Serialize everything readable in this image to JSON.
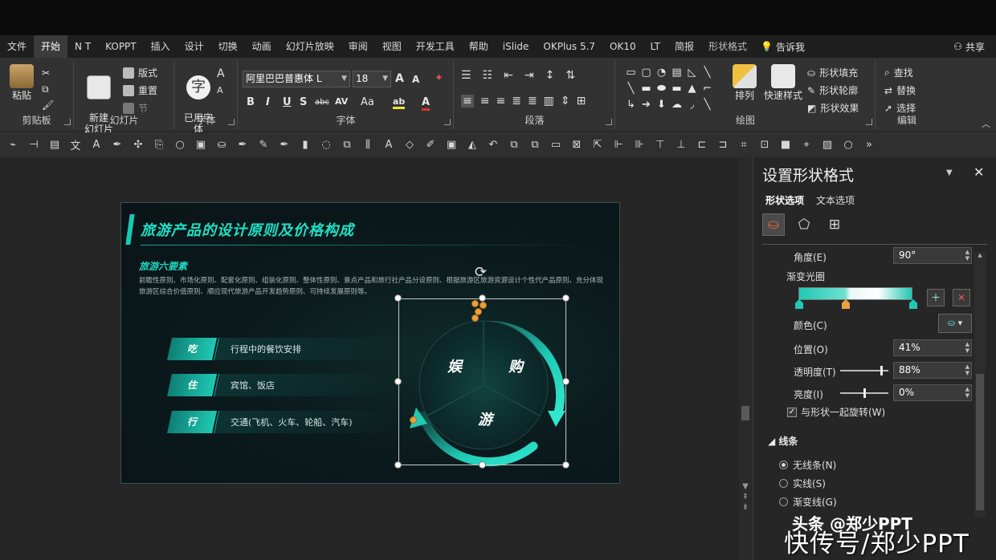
{
  "tabs": [
    "文件",
    "开始",
    "N T",
    "KOPPT",
    "插入",
    "设计",
    "切换",
    "动画",
    "幻灯片放映",
    "审阅",
    "视图",
    "开发工具",
    "帮助",
    "iSlide",
    "OKPlus 5.7",
    "OK10",
    "LT",
    "简报",
    "形状格式"
  ],
  "active_tab": "开始",
  "tell_me": "告诉我",
  "share": "共享",
  "ribbon": {
    "clipboard": {
      "paste": "粘贴",
      "label": "剪贴板"
    },
    "slides": {
      "new_slide": "新建\n幻灯片",
      "layout": "版式",
      "reset": "重置",
      "section": "节",
      "label": "幻灯片"
    },
    "font_used": {
      "btn": "已用字\n体",
      "label": "字体"
    },
    "font": {
      "family": "阿里巴巴普惠体 L",
      "size": "18",
      "label": "字体",
      "bold": "B",
      "italic": "I",
      "underline": "U",
      "strike": "S",
      "abc": "abc",
      "spacing": "AV",
      "case": "Aa"
    },
    "paragraph": {
      "label": "段落"
    },
    "drawing": {
      "arrange": "排列",
      "quick_styles": "快速样式",
      "fill": "形状填充",
      "outline": "形状轮廓",
      "effects": "形状效果",
      "label": "绘图"
    },
    "editing": {
      "find": "查找",
      "replace": "替换",
      "select": "选择",
      "label": "编辑"
    }
  },
  "slide": {
    "title": "旅游产品的设计原则及价格构成",
    "subtitle": "旅游六要素",
    "description": "前瞻性原则、市场化原则、配套化原则、组装化原则、整体性原则、景点产品和旅行社产品分设原则、根据旅游区旅游资源设计个性代产品原则、充分体现旅游区综合价值原则、顺应现代旅游产品开发趋势原则、可持续发展原则等。",
    "items": [
      {
        "tag": "吃",
        "text": "行程中的餐饮安排"
      },
      {
        "tag": "住",
        "text": "宾馆、饭店"
      },
      {
        "tag": "行",
        "text": "交通(飞机、火车、轮船、汽车)"
      }
    ],
    "segments": [
      "娱",
      "购",
      "游"
    ]
  },
  "pane": {
    "title": "设置形状格式",
    "tab_shape": "形状选项",
    "tab_text": "文本选项",
    "angle_label": "角度(E)",
    "angle_value": "90°",
    "gradient_label": "渐变光圈",
    "color_label": "颜色(C)",
    "position_label": "位置(O)",
    "position_value": "41%",
    "transparency_label": "透明度(T)",
    "transparency_value": "88%",
    "transparency_fraction": 0.88,
    "brightness_label": "亮度(I)",
    "brightness_value": "0%",
    "brightness_fraction": 0.5,
    "rotate_with_shape": "与形状一起旋转(W)",
    "line_section": "线条",
    "line_options": [
      "无线条(N)",
      "实线(S)",
      "渐变线(G)"
    ],
    "line_selected": 0
  },
  "watermark": {
    "line1": "头条 @郑少PPT",
    "line2": "快传号/郑少PPT"
  },
  "colors": {
    "accent": "#1fc9b3",
    "accent_dark": "#0e7f74",
    "title": "#20e0c5",
    "slide_bg": "#0b1a1d"
  }
}
